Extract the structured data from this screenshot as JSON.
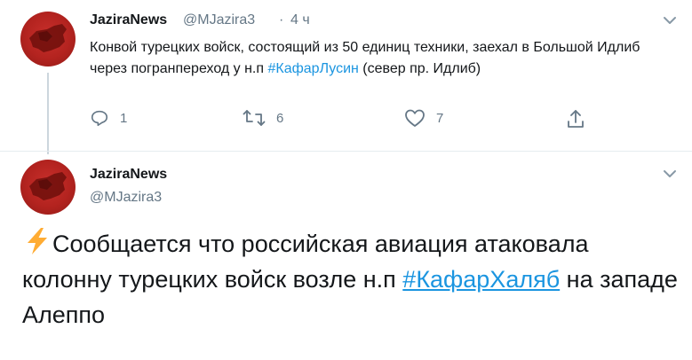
{
  "tweet1": {
    "author_name": "JaziraNews",
    "handle": "@MJazira3",
    "separator": "·",
    "time": "4 ч",
    "text_before": "Конвой турецких войск, состоящий из 50 единиц техники, заехал в Большой Идлиб через погранпереход у н.п ",
    "hashtag": "#КафарЛусин",
    "text_after": " (север пр. Идлиб)",
    "replies": "1",
    "retweets": "6",
    "likes": "7"
  },
  "tweet2": {
    "author_name": "JaziraNews",
    "handle": "@MJazira3",
    "emoji": "⚡",
    "text_before": "Сообщается что российская авиация атаковала колонну турецких войск возле н.п ",
    "hashtag": "#КафарХаляб",
    "text_after": " на западе Алеппо"
  },
  "colors": {
    "accent": "#1b95e0",
    "secondary_text": "#657786",
    "avatar_red": "#c9302c",
    "emoji_yellow": "#ffac33"
  },
  "icons": [
    "caret-down-icon",
    "reply-icon",
    "retweet-icon",
    "like-icon",
    "share-icon",
    "lightning-icon",
    "syria-map-icon"
  ]
}
